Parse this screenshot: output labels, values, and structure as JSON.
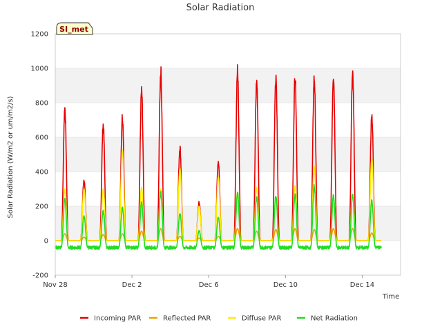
{
  "chart_data": {
    "type": "line",
    "title": "Solar Radiation",
    "xlabel": "Time",
    "ylabel": "Solar Radiation (W/m2 or um/m2/s)",
    "site_badge": "SI_met",
    "ylim": [
      -200,
      1200
    ],
    "yticks": [
      -200,
      0,
      200,
      400,
      600,
      800,
      1000,
      1200
    ],
    "xlim": [
      "2022-11-28",
      "2022-12-16"
    ],
    "xticks": [
      {
        "date": "2022-11-28",
        "label": "Nov 28"
      },
      {
        "date": "2022-12-02",
        "label": "Dec 2"
      },
      {
        "date": "2022-12-06",
        "label": "Dec 6"
      },
      {
        "date": "2022-12-10",
        "label": "Dec 10"
      },
      {
        "date": "2022-12-14",
        "label": "Dec 14"
      }
    ],
    "background_bands": true,
    "legend_position": "bottom",
    "daily_peaks": {
      "days": [
        "2022-11-28",
        "2022-11-29",
        "2022-11-30",
        "2022-12-01",
        "2022-12-02",
        "2022-12-03",
        "2022-12-04",
        "2022-12-05",
        "2022-12-06",
        "2022-12-07",
        "2022-12-08",
        "2022-12-09",
        "2022-12-10",
        "2022-12-11",
        "2022-12-12",
        "2022-12-13",
        "2022-12-14",
        "2022-12-15"
      ],
      "incoming": [
        800,
        370,
        700,
        750,
        900,
        1020,
        565,
        230,
        480,
        1025,
        960,
        975,
        1000,
        980,
        1005,
        1000,
        760,
        null
      ],
      "reflected": [
        40,
        20,
        35,
        40,
        55,
        70,
        25,
        15,
        25,
        70,
        55,
        65,
        70,
        65,
        70,
        70,
        45,
        null
      ],
      "diffuse": [
        300,
        300,
        300,
        525,
        310,
        300,
        420,
        200,
        370,
        280,
        310,
        250,
        320,
        430,
        250,
        270,
        480,
        null
      ],
      "net": [
        250,
        150,
        180,
        200,
        230,
        295,
        165,
        60,
        140,
        290,
        265,
        275,
        280,
        330,
        270,
        275,
        240,
        null
      ],
      "night_net": -40
    },
    "series": [
      {
        "name": "Incoming PAR",
        "color": "#e60000",
        "key": "incoming"
      },
      {
        "name": "Reflected PAR",
        "color": "#f0a000",
        "key": "reflected"
      },
      {
        "name": "Diffuse PAR",
        "color": "#ffee00",
        "key": "diffuse"
      },
      {
        "name": "Net Radiation",
        "color": "#22dd22",
        "key": "net"
      }
    ]
  }
}
